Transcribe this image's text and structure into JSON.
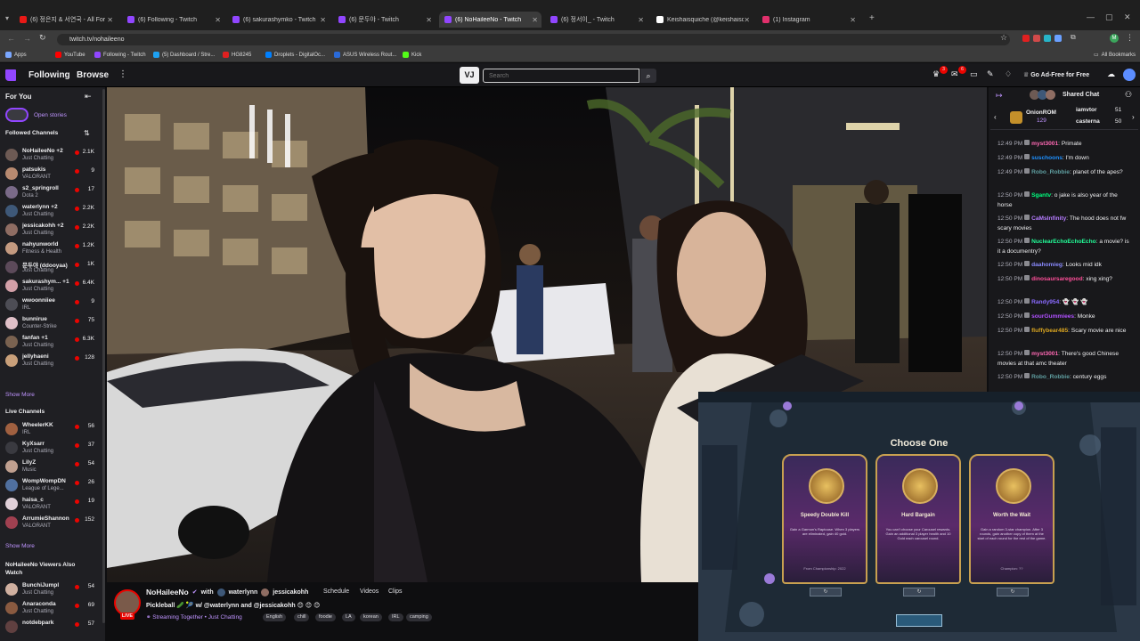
{
  "browser": {
    "tabs": [
      {
        "title": "(6) 정은지 & 서연국 - All For Yo",
        "color": "#e91916"
      },
      {
        "title": "(6) Following - Twitch",
        "color": "#9146ff"
      },
      {
        "title": "(6) sakurashymko - Twitch",
        "color": "#9146ff"
      },
      {
        "title": "(6) 문두야 - Twitch",
        "color": "#9146ff"
      },
      {
        "title": "(6) NoHaileeNo - Twitch",
        "color": "#9146ff"
      },
      {
        "title": "(6) 정서이_ - Twitch",
        "color": "#9146ff"
      },
      {
        "title": "Keishaisquiche (@keishaisquiche",
        "color": "#ffffff"
      },
      {
        "title": "(1) Instagram",
        "color": "#e1306c"
      }
    ],
    "url": "twitch.tv/nohaileeno",
    "bookmarks": [
      {
        "label": "Apps",
        "color": "#7aa7ff"
      },
      {
        "label": "YouTube",
        "color": "#ff0000"
      },
      {
        "label": "Following - Twitch",
        "color": "#9146ff"
      },
      {
        "label": "(5) Dashboard / Stre...",
        "color": "#1da1f2"
      },
      {
        "label": "HG8245",
        "color": "#e02020"
      },
      {
        "label": "Droplets - DigitalOc...",
        "color": "#0080ff"
      },
      {
        "label": "ASUS Wireless Rout...",
        "color": "#2a6ad8"
      },
      {
        "label": "Kick",
        "color": "#53fc18"
      }
    ],
    "all_bookmarks": "All Bookmarks"
  },
  "nav": {
    "following": "Following",
    "browse": "Browse",
    "search_placeholder": "Search",
    "ad_free": "Go Ad-Free for Free",
    "notif_badge_1": "3",
    "notif_badge_2": "6"
  },
  "sidebar": {
    "for_you": "For You",
    "open_stories": "Open stories",
    "followed_header": "Followed Channels",
    "followed": [
      {
        "name": "NoHaileeNo +2",
        "category": "Just Chatting",
        "viewers": "2.1K",
        "color": "#6d5a54"
      },
      {
        "name": "patsukis",
        "category": "VALORANT",
        "viewers": "9",
        "color": "#b88a70"
      },
      {
        "name": "s2_springroll",
        "category": "Dota 2",
        "viewers": "17",
        "color": "#7a6a88"
      },
      {
        "name": "waterlynn +2",
        "category": "Just Chatting",
        "viewers": "2.2K",
        "color": "#3e5878"
      },
      {
        "name": "jessicakohh +2",
        "category": "Just Chatting",
        "viewers": "2.2K",
        "color": "#8f6d63"
      },
      {
        "name": "nahyunworld",
        "category": "Fitness & Health",
        "viewers": "1.2K",
        "color": "#c49a80"
      },
      {
        "name": "문두야 (ddooyaa)",
        "category": "Just Chatting",
        "viewers": "1K",
        "color": "#5c4a5a"
      },
      {
        "name": "sakurashym... +1",
        "category": "Just Chatting",
        "viewers": "6.4K",
        "color": "#d3a0a8"
      },
      {
        "name": "wwoonniiee",
        "category": "IRL",
        "viewers": "9",
        "color": "#4d4d55"
      },
      {
        "name": "bunnirue",
        "category": "Counter-Strike",
        "viewers": "75",
        "color": "#e0c0c8"
      },
      {
        "name": "fanfan +1",
        "category": "Just Chatting",
        "viewers": "6.3K",
        "color": "#7a6250"
      },
      {
        "name": "jellyhaeni",
        "category": "Just Chatting",
        "viewers": "128",
        "color": "#c9a07a"
      }
    ],
    "show_more_1": "Show More",
    "live_header": "Live Channels",
    "live": [
      {
        "name": "WheelerKK",
        "category": "IRL",
        "viewers": "56",
        "color": "#a06040"
      },
      {
        "name": "KyXsarr",
        "category": "Just Chatting",
        "viewers": "37",
        "color": "#3a3a40"
      },
      {
        "name": "LilyZ",
        "category": "Music",
        "viewers": "54",
        "color": "#c0a090"
      },
      {
        "name": "WompWompDN",
        "category": "League of Lege...",
        "viewers": "26",
        "color": "#5070a0"
      },
      {
        "name": "haisa_c",
        "category": "VALORANT",
        "viewers": "19",
        "color": "#e0d0d8"
      },
      {
        "name": "ArrumieShannon",
        "category": "VALORANT",
        "viewers": "152",
        "color": "#a04050"
      }
    ],
    "show_more_2": "Show More",
    "viewers_also_header": "NoHaileeNo Viewers Also Watch",
    "also": [
      {
        "name": "BunchiJumpl",
        "category": "Just Chatting",
        "viewers": "54",
        "color": "#d0b0a0"
      },
      {
        "name": "Anaraconda",
        "category": "Just Chatting",
        "viewers": "69",
        "color": "#8a5a40"
      },
      {
        "name": "notdebpark",
        "category": "",
        "viewers": "57",
        "color": "#604040"
      }
    ]
  },
  "channel": {
    "name": "NoHaileeNo",
    "with": "with",
    "collab1": "waterlynn",
    "collab2": "jessicakohh",
    "tab_schedule": "Schedule",
    "tab_videos": "Videos",
    "tab_clips": "Clips",
    "live": "LIVE",
    "stream_title": "Pickleball 🥒 🎾 w/ @waterlynn and @jessicakohh 😊 😊 😊",
    "subline": "Streaming Together • Just Chatting",
    "tags": [
      "English",
      "chill",
      "foodie",
      "LA",
      "korean",
      "IRL",
      "camping"
    ]
  },
  "chat": {
    "header": "Shared Chat",
    "hype": [
      {
        "name": "OnionROM",
        "count": "129"
      },
      {
        "name": "iamvtor",
        "count": "51"
      },
      {
        "name": "casterna",
        "count": "50"
      }
    ],
    "messages": [
      {
        "time": "12:49 PM",
        "user": "myst3001",
        "color": "#ff69b4",
        "text": "Primate"
      },
      {
        "time": "12:49 PM",
        "user": "suschoons",
        "color": "#1e90ff",
        "text": "I'm down"
      },
      {
        "time": "12:49 PM",
        "user": "Robo_Robbie",
        "color": "#5f9ea0",
        "text": "planet of the apes?"
      },
      {
        "time": "12:50 PM",
        "user": "Sgantv",
        "color": "#00ff7f",
        "text": "o jake is also year of the horse"
      },
      {
        "time": "12:50 PM",
        "user": "CaMsInfinity",
        "color": "#b57cff",
        "text": "The hood does not fw scary movies"
      },
      {
        "time": "12:50 PM",
        "user": "NuclearEchoEchoEcho",
        "color": "#22ff99",
        "text": "a movie? is it a documentry?"
      },
      {
        "time": "12:50 PM",
        "user": "daahomieg",
        "color": "#8a8aff",
        "text": "Looks mid idk"
      },
      {
        "time": "12:50 PM",
        "user": "dinosaursaregood",
        "color": "#ff4f9a",
        "text": "xing xing?"
      },
      {
        "time": "12:50 PM",
        "user": "Randy954",
        "color": "#8a6aff",
        "text": "👻 👻 👻"
      },
      {
        "time": "12:50 PM",
        "user": "sourGummiees",
        "color": "#b050ff",
        "text": "Monke"
      },
      {
        "time": "12:50 PM",
        "user": "fluffybear485",
        "color": "#daa520",
        "text": "Scary movie are nice"
      },
      {
        "time": "12:50 PM",
        "user": "myst3001",
        "color": "#ff69b4",
        "text": "There's good Chinese movies at that amc theater"
      },
      {
        "time": "12:50 PM",
        "user": "Robo_Robbie",
        "color": "#5f9ea0",
        "text": "century eggs"
      }
    ]
  },
  "game": {
    "choose_title": "Choose One",
    "cards": [
      {
        "name": "Speedy Double Kill",
        "desc": "Gain a Garmon's Raptouse. When 3 players are eliminated, gain 40 gold.",
        "footer": "From Championship: 2022"
      },
      {
        "name": "Hard Bargain",
        "desc": "You can't choose your Carousel rewards. Gain an additional 3 player health and 10 Gold each carousel round.",
        "footer": ""
      },
      {
        "name": "Worth the Wait",
        "desc": "Gain a random 3-star champion. After 3 rounds, gain another copy of them at the start of each round for the rest of the game.",
        "footer": "Champion: ??"
      }
    ]
  }
}
